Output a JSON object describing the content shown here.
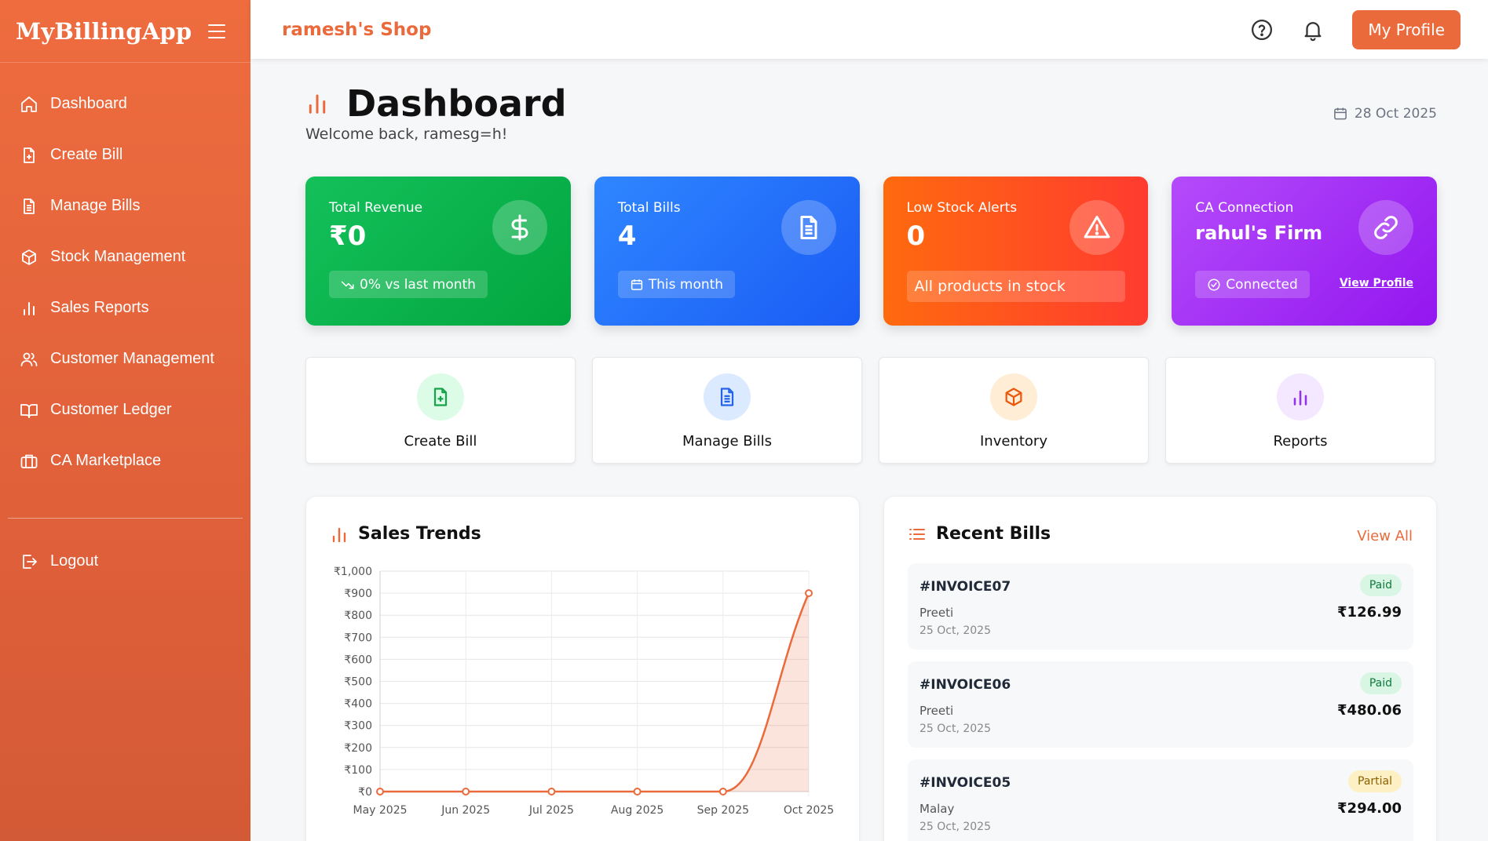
{
  "sidebar": {
    "brand": "MyBillingApp",
    "items": [
      {
        "label": "Dashboard",
        "icon": "home-icon"
      },
      {
        "label": "Create Bill",
        "icon": "file-plus-icon"
      },
      {
        "label": "Manage Bills",
        "icon": "file-text-icon"
      },
      {
        "label": "Stock Management",
        "icon": "box-icon"
      },
      {
        "label": "Sales Reports",
        "icon": "bar-chart-icon"
      },
      {
        "label": "Customer Management",
        "icon": "users-icon"
      },
      {
        "label": "Customer Ledger",
        "icon": "book-icon"
      },
      {
        "label": "CA Marketplace",
        "icon": "briefcase-icon"
      }
    ],
    "logout": "Logout"
  },
  "header": {
    "shop_name": "ramesh's Shop",
    "profile_button": "My Profile"
  },
  "page": {
    "title": "Dashboard",
    "welcome": "Welcome back, ramesg=h!",
    "date": "28 Oct 2025"
  },
  "stats": {
    "revenue": {
      "label": "Total Revenue",
      "value": "₹0",
      "chip": "0% vs last month"
    },
    "bills": {
      "label": "Total Bills",
      "value": "4",
      "chip": "This month"
    },
    "stock": {
      "label": "Low Stock Alerts",
      "value": "0",
      "chip": "All products in stock"
    },
    "ca": {
      "label": "CA Connection",
      "value": "rahul's Firm",
      "chip": "Connected",
      "link": "View Profile"
    }
  },
  "quick_actions": [
    {
      "label": "Create Bill"
    },
    {
      "label": "Manage Bills"
    },
    {
      "label": "Inventory"
    },
    {
      "label": "Reports"
    }
  ],
  "sales_trends": {
    "title": "Sales Trends"
  },
  "chart_data": {
    "type": "area",
    "title": "Sales Trends",
    "categories": [
      "May 2025",
      "Jun 2025",
      "Jul 2025",
      "Aug 2025",
      "Sep 2025",
      "Oct 2025"
    ],
    "values": [
      0,
      0,
      0,
      0,
      0,
      900
    ],
    "ylim": [
      0,
      1000
    ],
    "yticks": [
      "₹0",
      "₹100",
      "₹200",
      "₹300",
      "₹400",
      "₹500",
      "₹600",
      "₹700",
      "₹800",
      "₹900",
      "₹1,000"
    ],
    "color": "#ea6a3c",
    "grid": true
  },
  "recent_bills": {
    "title": "Recent Bills",
    "view_all": "View All",
    "items": [
      {
        "id": "#INVOICE07",
        "customer": "Preeti",
        "date": "25 Oct, 2025",
        "status": "Paid",
        "amount": "₹126.99"
      },
      {
        "id": "#INVOICE06",
        "customer": "Preeti",
        "date": "25 Oct, 2025",
        "status": "Paid",
        "amount": "₹480.06"
      },
      {
        "id": "#INVOICE05",
        "customer": "Malay",
        "date": "25 Oct, 2025",
        "status": "Partial",
        "amount": "₹294.00"
      }
    ]
  },
  "colors": {
    "accent": "#ea6a3c",
    "green": "#02a63f",
    "blue": "#1a5cf5",
    "orange": "#ff3b2f",
    "purple": "#9316ef"
  }
}
